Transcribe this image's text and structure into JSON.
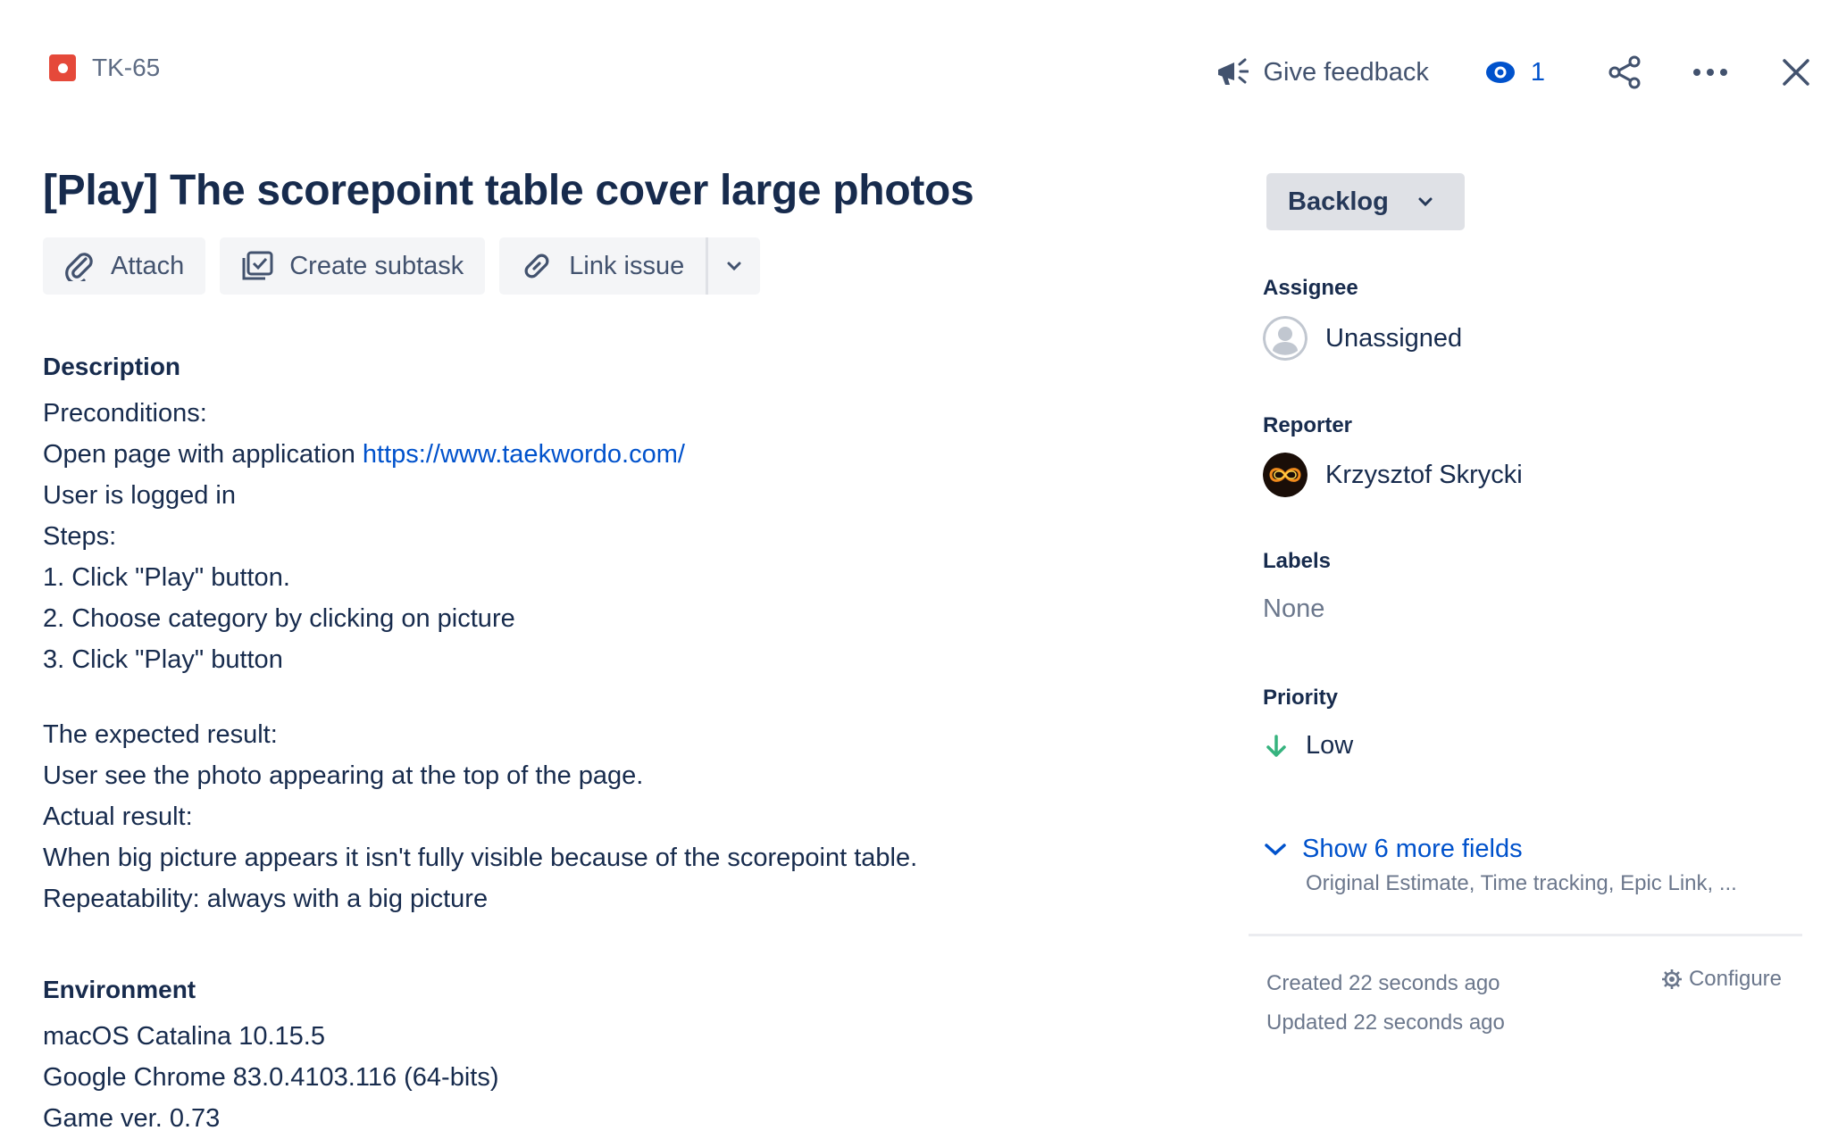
{
  "header": {
    "issue_key": "TK-65",
    "issue_type_icon": "bug-icon",
    "feedback_label": "Give feedback",
    "watch_count": "1"
  },
  "issue": {
    "title": "[Play] The scorepoint table cover large photos"
  },
  "toolbar": {
    "attach_label": "Attach",
    "create_subtask_label": "Create subtask",
    "link_issue_label": "Link issue"
  },
  "description": {
    "heading": "Description",
    "preconditions_label": "Preconditions:",
    "open_page_text": "Open page with application ",
    "url": "https://www.taekwordo.com/",
    "logged_in": "User is logged in",
    "steps_label": "Steps:",
    "steps": [
      "1. Click \"Play\" button.",
      "2. Choose category by clicking on picture",
      "3. Click \"Play\" button"
    ],
    "expected_label": "The expected result:",
    "expected_text": "User see the photo appearing at the top of the page.",
    "actual_label": "Actual result:",
    "actual_text": "When big picture appears it isn't fully visible because of the scorepoint table.",
    "repeatability": "Repeatability: always with a big picture"
  },
  "environment": {
    "heading": "Environment",
    "lines": [
      "macOS Catalina 10.15.5",
      "Google Chrome 83.0.4103.116 (64-bits)",
      "Game ver. 0.73"
    ]
  },
  "sidebar": {
    "status": "Backlog",
    "assignee_label": "Assignee",
    "assignee_value": "Unassigned",
    "reporter_label": "Reporter",
    "reporter_value": "Krzysztof Skrycki",
    "labels_label": "Labels",
    "labels_value": "None",
    "priority_label": "Priority",
    "priority_value": "Low",
    "show_more": "Show 6 more fields",
    "show_more_sub": "Original Estimate, Time tracking, Epic Link, ...",
    "created": "Created 22 seconds ago",
    "updated": "Updated 22 seconds ago",
    "configure": "Configure"
  },
  "colors": {
    "link": "#0052cc",
    "bug": "#e5493a",
    "priority_low": "#36b37e"
  }
}
